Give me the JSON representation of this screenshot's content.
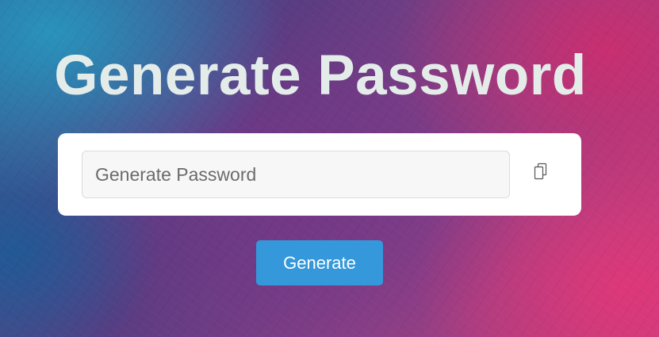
{
  "page": {
    "title": "Generate Password"
  },
  "generator": {
    "password_value": "",
    "password_placeholder": "Generate Password",
    "copy_icon": "copy-icon",
    "generate_label": "Generate"
  },
  "colors": {
    "title_text": "#e4ecea",
    "card_background": "#ffffff",
    "input_background": "#f7f7f7",
    "button_background": "#3498db",
    "button_text": "#ffffff"
  }
}
